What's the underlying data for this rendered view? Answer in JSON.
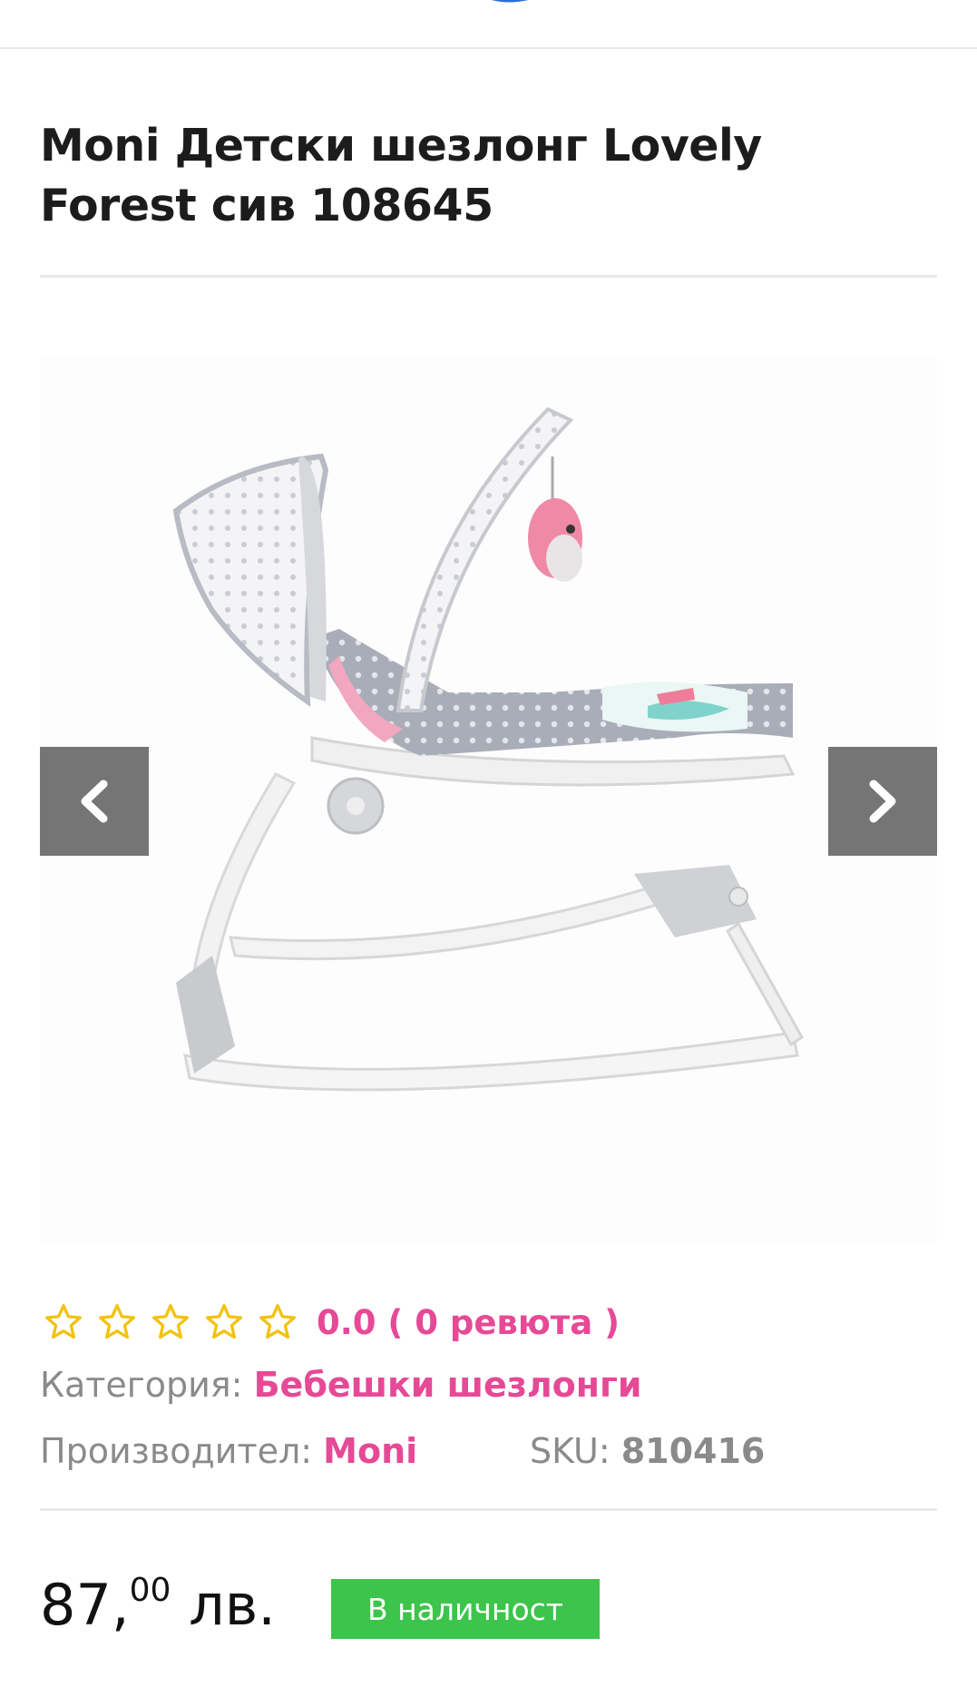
{
  "header": {
    "logo_icon": "store-logo-icon"
  },
  "product": {
    "title_line1": "Moni Детски шезлонг Lovely",
    "title_line2": "Forest сив 108645",
    "image_alt": "rocking-baby-bouncer-image"
  },
  "gallery": {
    "prev_icon": "chevron-left-icon",
    "next_icon": "chevron-right-icon"
  },
  "rating": {
    "stars": 0,
    "max_stars": 5,
    "text": "0.0 ( 0 ревюта )",
    "star_color": "#f2c20f"
  },
  "meta": {
    "category_label": "Категория:",
    "category_value": "Бебешки шезлонги",
    "maker_label": "Производител:",
    "maker_value": "Moni",
    "sku_label": "SKU:",
    "sku_value": "810416"
  },
  "price": {
    "whole": "87,",
    "cents": "00",
    "currency": "лв."
  },
  "stock": {
    "label": "В наличност",
    "color": "#3cc44b"
  },
  "colors": {
    "accent": "#e64996",
    "nav_button": "#757575"
  }
}
